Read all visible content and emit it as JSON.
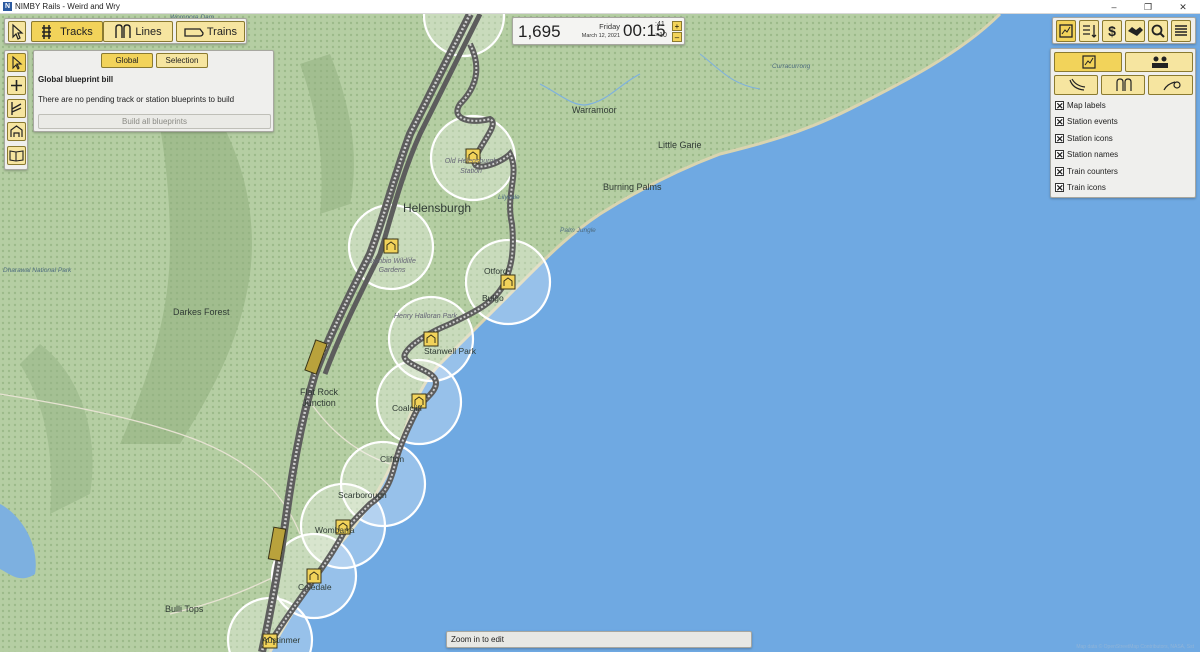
{
  "window": {
    "title": "NIMBY Rails - Weird and Wry",
    "minimize": "–",
    "maximize": "❐",
    "close": "✕"
  },
  "toolbar": {
    "tracks_label": "Tracks",
    "lines_label": "Lines",
    "trains_label": "Trains"
  },
  "blueprint": {
    "tab_global": "Global",
    "tab_selection": "Selection",
    "title": "Global blueprint bill",
    "message": "There are no pending track or station blueprints to build",
    "build_button": "Build all blueprints"
  },
  "clock": {
    "money": "1,695",
    "day": "Friday",
    "date": "March 12, 2021",
    "time": "00:15",
    "seconds": ":41",
    "speed": "×10",
    "plus": "+",
    "minus": "–"
  },
  "layers": {
    "items": [
      {
        "label": "Map labels",
        "checked": true
      },
      {
        "label": "Station events",
        "checked": true
      },
      {
        "label": "Station icons",
        "checked": true
      },
      {
        "label": "Station names",
        "checked": true
      },
      {
        "label": "Train counters",
        "checked": true
      },
      {
        "label": "Train icons",
        "checked": true
      }
    ]
  },
  "statusbar": {
    "message": "Zoom in to edit"
  },
  "attribution": "Map data © OpenStreetMap Contributors, NASA, Sst",
  "map": {
    "labels": {
      "helensburgh": "Helensburgh",
      "warramoor": "Warramoor",
      "little_garie": "Little Garie",
      "burning_palms": "Burning Palms",
      "palm_jungle": "Palm Jungle",
      "curracurrong": "Curracurrong",
      "dharawal": "Dharawal National Park",
      "darkes_forest": "Darkes Forest",
      "flat_rock": "Flat Rock Junction",
      "bulli_tops": "Bulli Tops",
      "otford": "Otford",
      "bulgo": "Bulgo",
      "stanwell_park": "Stanwell Park",
      "coalcliff": "Coalcliff",
      "clifton": "Clifton",
      "scarborough": "Scarborough",
      "wombarra": "Wombarra",
      "coledale": "Coledale",
      "austinmer": "Austinmer",
      "old_helensburgh": "Old Helensburgh Station",
      "symbio": "Symbio Wildlife Gardens",
      "henry_halloran": "Henry Halloran Park",
      "lilyvale": "Lilyvale",
      "woronora": "Woronora Dam"
    }
  },
  "colors": {
    "sea": "#6fa9e2",
    "land": "#b6cfa4",
    "accent": "#f2d35a",
    "track": "#555555"
  }
}
